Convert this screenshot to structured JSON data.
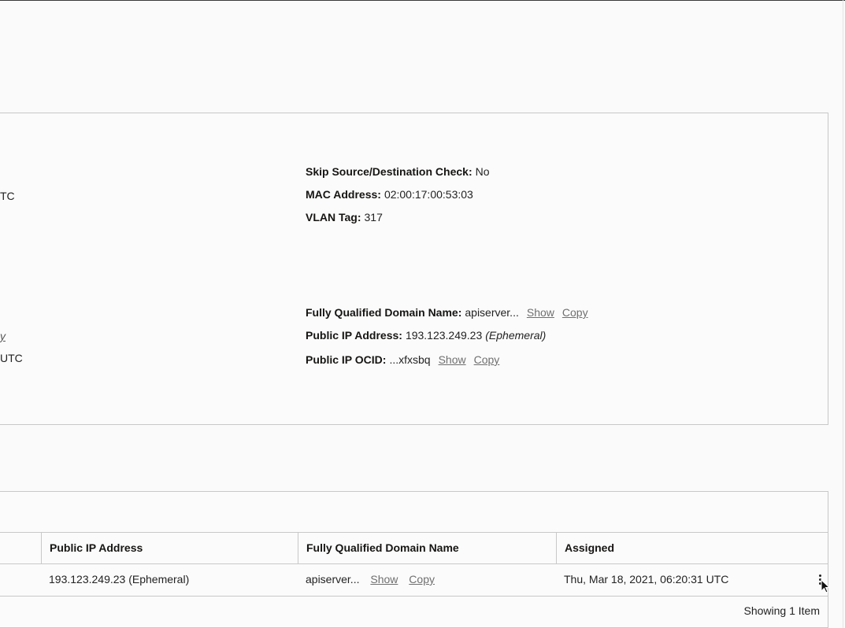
{
  "left_fragments": {
    "frag1": "TC",
    "frag2": "y",
    "frag3": "UTC"
  },
  "vnic": {
    "skip_check_label": "Skip Source/Destination Check:",
    "skip_check_value": "No",
    "mac_label": "MAC Address:",
    "mac_value": "02:00:17:00:53:03",
    "vlan_label": "VLAN Tag:",
    "vlan_value": "317",
    "fqdn_label": "Fully Qualified Domain Name:",
    "fqdn_value": "apiserver...",
    "public_ip_label": "Public IP Address:",
    "public_ip_value": "193.123.249.23",
    "public_ip_type": "(Ephemeral)",
    "public_ip_ocid_label": "Public IP OCID:",
    "public_ip_ocid_value": "...xfxsbq",
    "show_label": "Show",
    "copy_label": "Copy"
  },
  "table": {
    "columns": [
      "Public IP Address",
      "Fully Qualified Domain Name",
      "Assigned"
    ],
    "rows": [
      {
        "public_ip": "193.123.249.23 (Ephemeral)",
        "fqdn": "apiserver...",
        "show": "Show",
        "copy": "Copy",
        "assigned": "Thu, Mar 18, 2021, 06:20:31 UTC"
      }
    ],
    "footer": "Showing 1 Item"
  }
}
